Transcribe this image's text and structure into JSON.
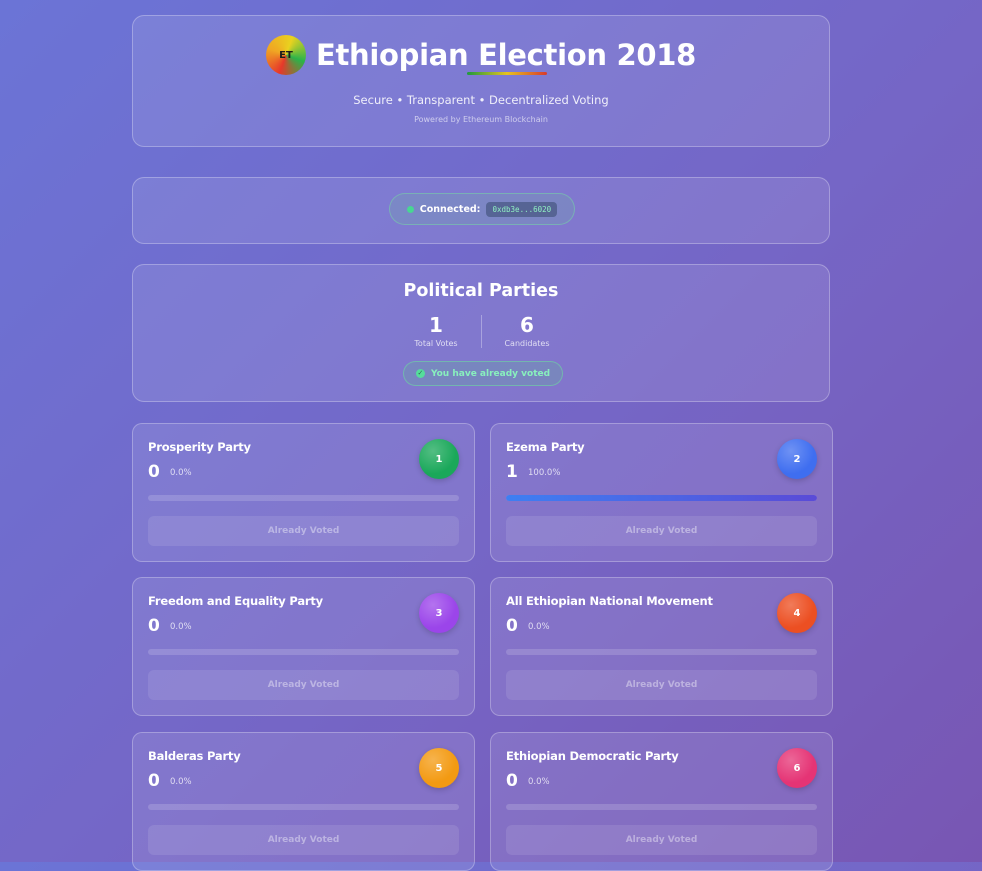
{
  "header": {
    "logo_text": "ET",
    "title": "Ethiopian Election 2018",
    "subtitle": "Secure • Transparent • Decentralized Voting",
    "powered_by": "Powered by Ethereum Blockchain",
    "flag_colors": [
      "#1f9a3d",
      "#e6c21f",
      "#d93a2d"
    ]
  },
  "connection": {
    "label": "Connected:",
    "address": "0xdb3e...6020",
    "status_color": "#48d693"
  },
  "stats": {
    "title": "Political Parties",
    "total_votes": "1",
    "total_votes_label": "Total Votes",
    "candidates": "6",
    "candidates_label": "Candidates",
    "voted_status": "You have already voted",
    "check_icon": "✓"
  },
  "parties": [
    {
      "name": "Prosperity Party",
      "votes": "0",
      "percent": "0.0%",
      "badge": "1",
      "badge_color": "#1aa85a",
      "share": 0,
      "button": "Already Voted"
    },
    {
      "name": "Ezema Party",
      "votes": "1",
      "percent": "100.0%",
      "badge": "2",
      "badge_color": "#3f6ef0",
      "share": 1,
      "button": "Already Voted"
    },
    {
      "name": "Freedom and Equality Party",
      "votes": "0",
      "percent": "0.0%",
      "badge": "3",
      "badge_color": "#9b45ea",
      "share": 0,
      "button": "Already Voted"
    },
    {
      "name": "All Ethiopian National Movement",
      "votes": "0",
      "percent": "0.0%",
      "badge": "4",
      "badge_color": "#ec4f22",
      "share": 0,
      "button": "Already Voted"
    },
    {
      "name": "Balderas Party",
      "votes": "0",
      "percent": "0.0%",
      "badge": "5",
      "badge_color": "#f39a12",
      "share": 0,
      "button": "Already Voted"
    },
    {
      "name": "Ethiopian Democratic Party",
      "votes": "0",
      "percent": "0.0%",
      "badge": "6",
      "badge_color": "#e53475",
      "share": 0,
      "button": "Already Voted"
    }
  ]
}
